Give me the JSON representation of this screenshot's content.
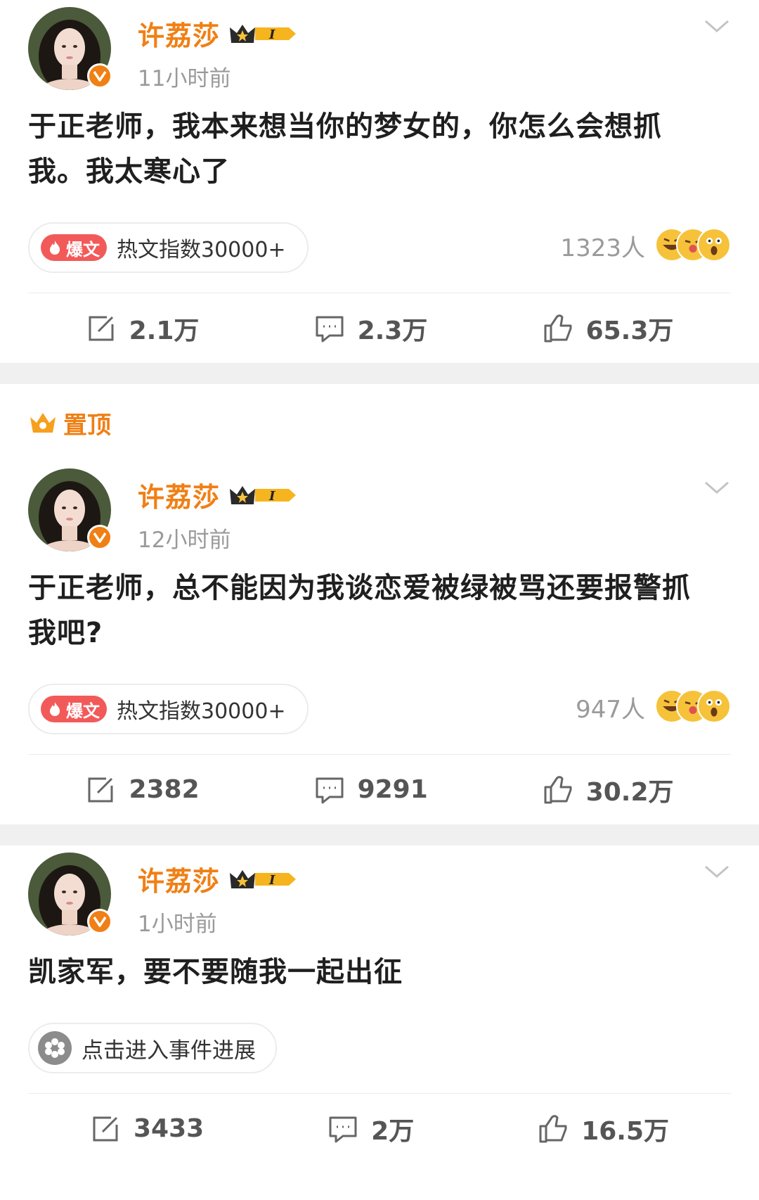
{
  "colors": {
    "accent": "#f07f14",
    "hot_red": "#f25a5a",
    "muted": "#9a9a9a",
    "separator": "#f0f0f0"
  },
  "posts": [
    {
      "username": "许荔莎",
      "vip_level": "I",
      "time": "11小时前",
      "text": "于正老师，我本来想当你的梦女的，你怎么会想抓我。我太寒心了",
      "hot_tag": "爆文",
      "hot_text": "热文指数30000+",
      "reaction_count": "1323人",
      "reposts": "2.1万",
      "comments": "2.3万",
      "likes": "65.3万"
    },
    {
      "pinned_label": "置顶",
      "username": "许荔莎",
      "vip_level": "I",
      "time": "12小时前",
      "text": "于正老师，总不能因为我谈恋爱被绿被骂还要报警抓我吧?",
      "hot_tag": "爆文",
      "hot_text": "热文指数30000+",
      "reaction_count": "947人",
      "reposts": "2382",
      "comments": "9291",
      "likes": "30.2万"
    },
    {
      "username": "许荔莎",
      "vip_level": "I",
      "time": "1小时前",
      "text": "凯家军，要不要随我一起出征",
      "event_text": "点击进入事件进展",
      "reposts": "3433",
      "comments": "2万",
      "likes": "16.5万"
    }
  ]
}
